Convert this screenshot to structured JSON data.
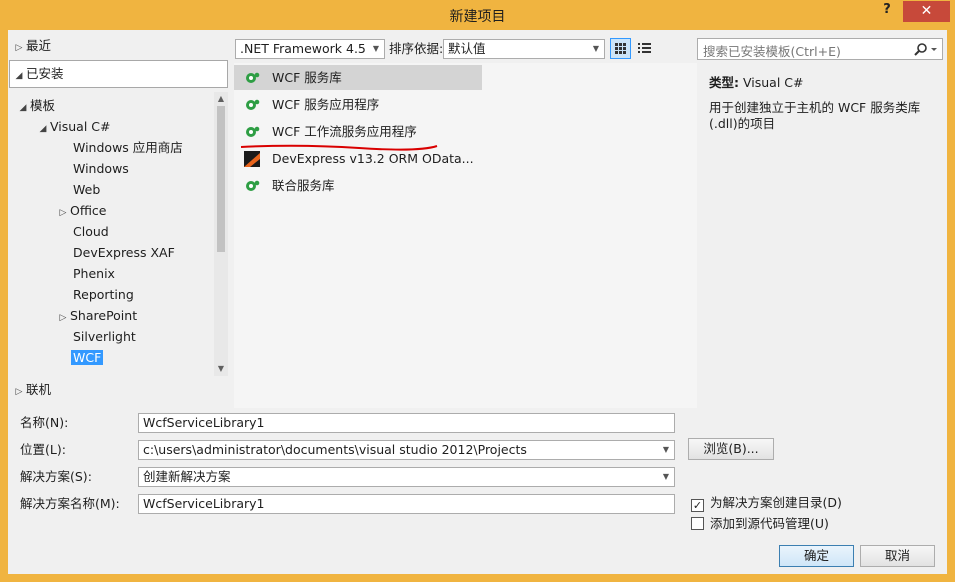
{
  "window": {
    "title": "新建项目",
    "help": "?",
    "close": "✕"
  },
  "left": {
    "recent": "最近",
    "installed": "已安装",
    "templates": "模板",
    "visual_csharp": "Visual C#",
    "items": [
      "Windows 应用商店",
      "Windows",
      "Web",
      "Office",
      "Cloud",
      "DevExpress XAF",
      "Phenix",
      "Reporting",
      "SharePoint",
      "Silverlight",
      "WCF"
    ],
    "online": "联机"
  },
  "toolbar": {
    "framework": ".NET Framework 4.5",
    "sort_label": "排序依据:",
    "sort_value": "默认值"
  },
  "templates": [
    {
      "name": "WCF 服务库",
      "icon": "gear-icon"
    },
    {
      "name": "WCF 服务应用程序",
      "icon": "gear-icon"
    },
    {
      "name": "WCF 工作流服务应用程序",
      "icon": "gear-icon"
    },
    {
      "name": "DevExpress v13.2 ORM OData...",
      "icon": "devexpress-icon"
    },
    {
      "name": "联合服务库",
      "icon": "gear-icon"
    }
  ],
  "search": {
    "placeholder": "搜索已安装模板(Ctrl+E)"
  },
  "info": {
    "type_label": "类型:",
    "type_value": "Visual C#",
    "description": "用于创建独立于主机的 WCF 服务类库(.dll)的项目"
  },
  "form": {
    "name_label": "名称(N):",
    "name_value": "WcfServiceLibrary1",
    "location_label": "位置(L):",
    "location_value": "c:\\users\\administrator\\documents\\visual studio 2012\\Projects",
    "browse": "浏览(B)...",
    "solution_label": "解决方案(S):",
    "solution_value": "创建新解决方案",
    "solution_name_label": "解决方案名称(M):",
    "solution_name_value": "WcfServiceLibrary1",
    "create_dir": "为解决方案创建目录(D)",
    "add_source_control": "添加到源代码管理(U)",
    "ok": "确定",
    "cancel": "取消"
  }
}
